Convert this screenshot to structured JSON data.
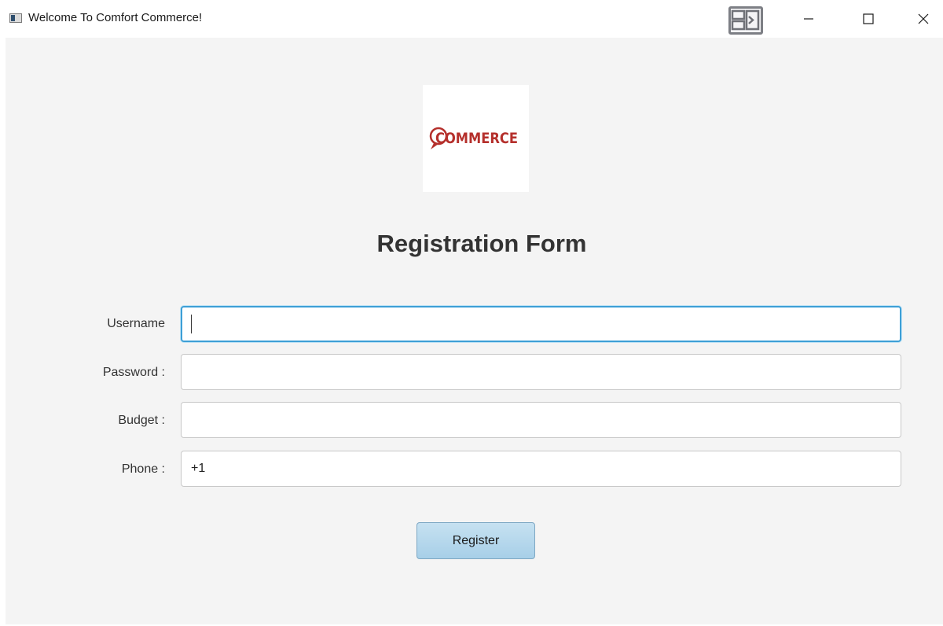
{
  "window": {
    "title": "Welcome To Comfort Commerce!"
  },
  "logo": {
    "text": "COMMERCE",
    "color": "#b5302c"
  },
  "form": {
    "title": "Registration Form",
    "fields": [
      {
        "label": "Username",
        "value": ""
      },
      {
        "label": "Password :",
        "value": ""
      },
      {
        "label": "Budget :",
        "value": ""
      },
      {
        "label": "Phone :",
        "value": "+1"
      }
    ],
    "register_label": "Register"
  },
  "colors": {
    "content_bg": "#f4f4f4",
    "focus_border": "#3d9fd6",
    "button_bg": "#b3d7ec"
  }
}
